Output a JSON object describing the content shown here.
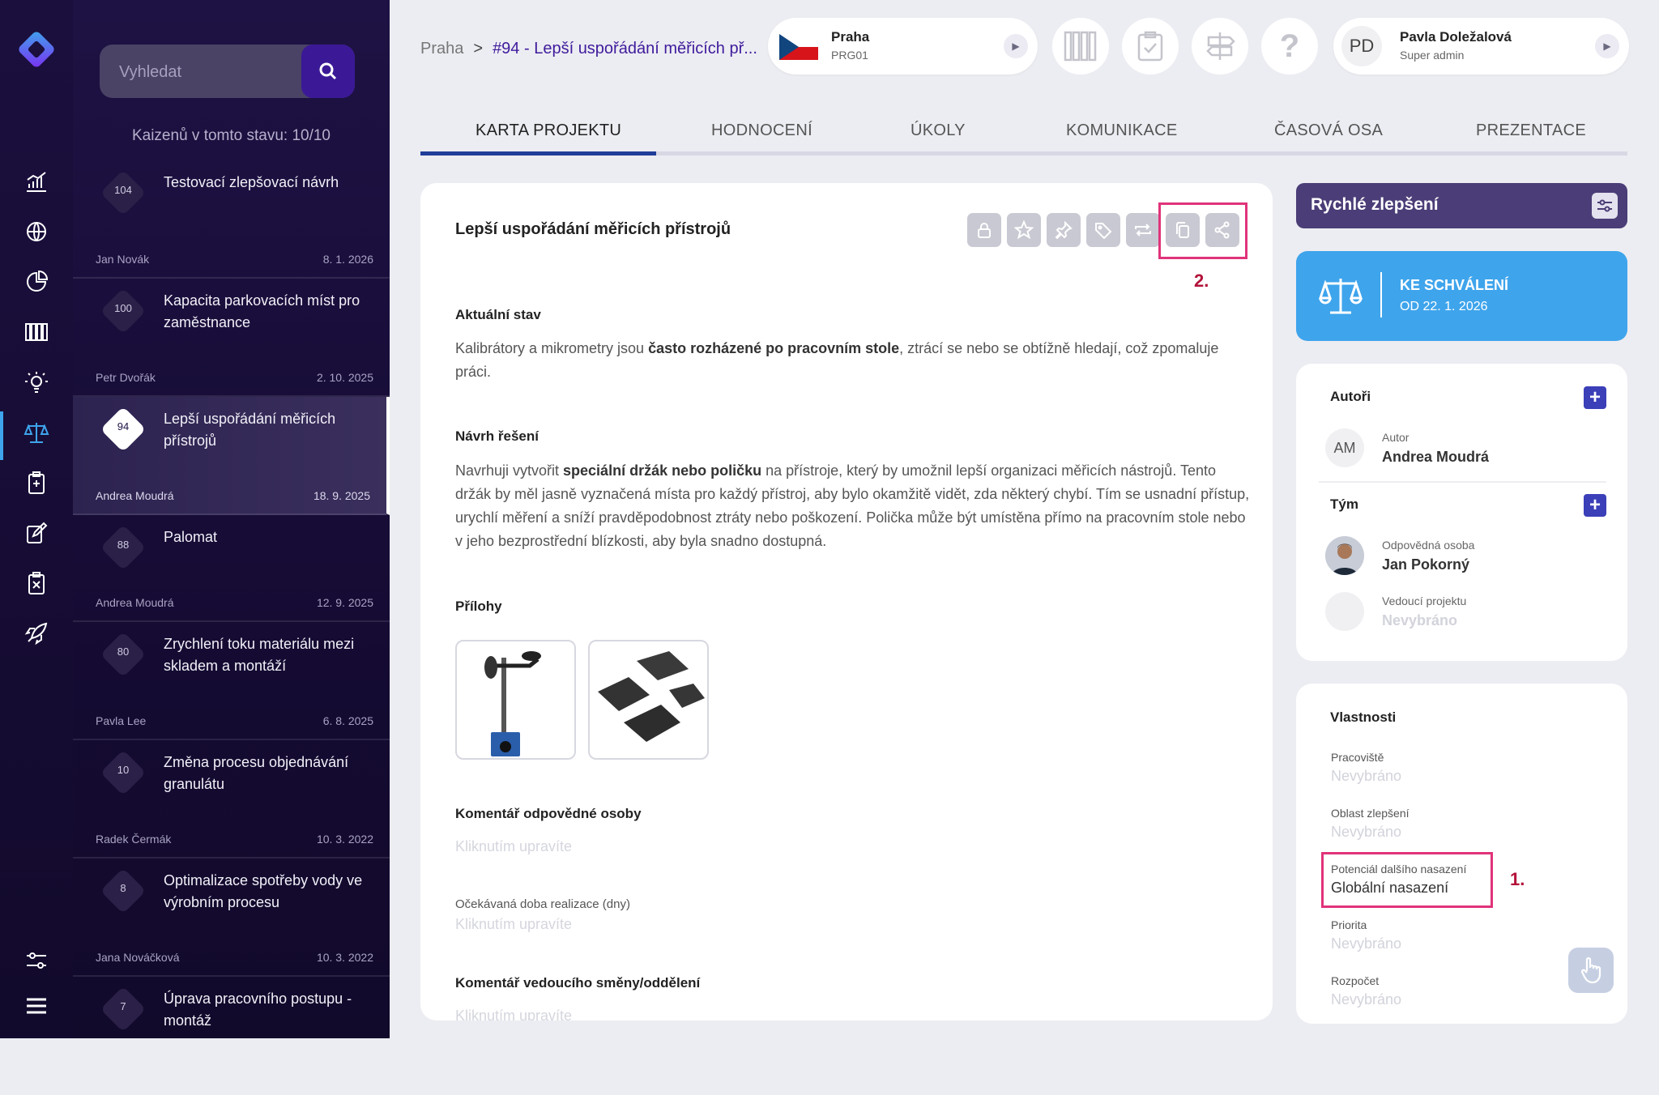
{
  "search": {
    "placeholder": "Vyhledat"
  },
  "list": {
    "count_label": "Kaizenů v tomto stavu: 10/10",
    "items": [
      {
        "num": "104",
        "title": "Testovací zlepšovací návrh",
        "author": "Jan Novák",
        "date": "8. 1. 2026"
      },
      {
        "num": "100",
        "title": "Kapacita parkovacích míst pro zaměstnance",
        "author": "Petr Dvořák",
        "date": "2. 10. 2025"
      },
      {
        "num": "94",
        "title": "Lepší uspořádání měřicích přístrojů",
        "author": "Andrea Moudrá",
        "date": "18. 9. 2025"
      },
      {
        "num": "88",
        "title": "Palomat",
        "author": "Andrea Moudrá",
        "date": "12. 9. 2025"
      },
      {
        "num": "80",
        "title": "Zrychlení toku materiálu mezi skladem a montáží",
        "author": "Pavla Lee",
        "date": "6. 8. 2025"
      },
      {
        "num": "10",
        "title": "Změna procesu objednávání granulátu",
        "author": "Radek Čermák",
        "date": "10. 3. 2022"
      },
      {
        "num": "8",
        "title": "Optimalizace spotřeby vody ve výrobním procesu",
        "author": "Jana Nováčková",
        "date": "10. 3. 2022"
      },
      {
        "num": "7",
        "title": "Úprava pracovního postupu - montáž",
        "author": "",
        "date": ""
      }
    ]
  },
  "breadcrumb": {
    "root": "Praha",
    "sep": ">",
    "current": "#94 - Lepší uspořádání měřicích př..."
  },
  "location": {
    "name": "Praha",
    "code": "PRG01"
  },
  "user": {
    "initials": "PD",
    "name": "Pavla Doležalová",
    "role": "Super admin"
  },
  "tabs": [
    "KARTA PROJEKTU",
    "HODNOCENÍ",
    "ÚKOLY",
    "KOMUNIKACE",
    "ČASOVÁ OSA",
    "PREZENTACE"
  ],
  "project": {
    "title": "Lepší uspořádání měřicích přístrojů",
    "current_state_label": "Aktuální stav",
    "current_state_a": "Kalibrátory a mikrometry jsou ",
    "current_state_b": "často rozházené po pracovním stole",
    "current_state_c": ", ztrácí se nebo se obtížně hledají, což zpomaluje práci.",
    "solution_label": "Návrh řešení",
    "solution_a": "Navrhuji vytvořit ",
    "solution_b": "speciální držák nebo poličku",
    "solution_c": " na přístroje, který by umožnil lepší organizaci měřicích nástrojů. Tento držák by měl jasně vyznačená místa pro každý přístroj, aby bylo okamžitě vidět, zda některý chybí. Tím se usnadní přístup, urychlí měření a sníží pravděpodobnost ztráty nebo poškození. Polička může být umístěna přímo na pracovním stole nebo v jeho bezprostřední blízkosti, aby byla snadno dostupná.",
    "attachments_label": "Přílohy",
    "comment_resp_label": "Komentář odpovědné osoby",
    "click_to_edit": "Kliknutím upravíte",
    "expected_label": "Očekávaná doba realizace (dny)",
    "comment_lead_label": "Komentář vedoucího směny/oddělení",
    "mark_2": "2."
  },
  "quick": {
    "title": "Rychlé zlepšení"
  },
  "state": {
    "title": "KE SCHVÁLENÍ",
    "since": "OD 22. 1. 2026",
    "color": "#3ea4ec"
  },
  "people": {
    "authors_label": "Autoři",
    "author_initials": "AM",
    "author_role": "Autor",
    "author_name": "Andrea Moudrá",
    "team_label": "Tým",
    "resp_role": "Odpovědná osoba",
    "resp_name": "Jan Pokorný",
    "lead_role": "Vedoucí projektu",
    "lead_name": "Nevybráno"
  },
  "properties": {
    "title": "Vlastnosti",
    "items": [
      {
        "label": "Pracoviště",
        "value": "Nevybráno"
      },
      {
        "label": "Oblast zlepšení",
        "value": "Nevybráno"
      },
      {
        "label": "Potenciál dalšího nasazení",
        "value": "Globální nasazení"
      },
      {
        "label": "Priorita",
        "value": "Nevybráno"
      },
      {
        "label": "Rozpočet",
        "value": "Nevybráno"
      }
    ],
    "mark_1": "1."
  },
  "colors": {
    "accent": "#3f1b9c",
    "highlight": "#e0337a",
    "annotation": "#b3123a"
  }
}
